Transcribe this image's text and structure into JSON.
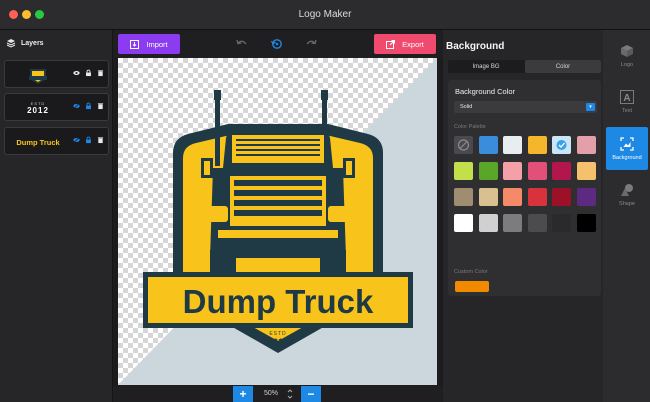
{
  "window": {
    "title": "Logo Maker"
  },
  "colors": {
    "accent": "#1e88e5",
    "import": "#8c3cf0",
    "export": "#f04a6e",
    "truck_yellow": "#f8c41c",
    "truck_dark": "#1f3a45"
  },
  "layers": {
    "title": "Layers",
    "items": [
      {
        "name": "truck-logo",
        "text": ""
      },
      {
        "name": "estd-2012",
        "text_top": "ESTD",
        "text_main": "2012"
      },
      {
        "name": "dump-truck-text",
        "text": "Dump Truck"
      }
    ]
  },
  "toolbar": {
    "import_label": "Import",
    "export_label": "Export"
  },
  "logo": {
    "title": "Dump Truck",
    "estd": "ESTD",
    "year": "2012"
  },
  "zoom": {
    "value": "50%",
    "plus": "+",
    "minus": "−"
  },
  "properties": {
    "title": "Background",
    "tabs": [
      {
        "label": "Image BG"
      },
      {
        "label": "Color"
      }
    ],
    "section_title": "Background Color",
    "fill_type": "Solid",
    "palette_label": "Color Palette",
    "custom_label": "Custom Color",
    "custom_color": "#f28a00",
    "palette": [
      "none",
      "#3a8ddb",
      "#e8eef0",
      "#f6b62b",
      "selected",
      "#e4a0a8",
      "#c3e04a",
      "#5aa628",
      "#f4a0a8",
      "#e2507a",
      "#b3164c",
      "#f5c16c",
      "#a08c70",
      "#d8c090",
      "#f58a68",
      "#d8323c",
      "#9c1028",
      "#5c2a80",
      "#ffffff",
      "#d0d0d0",
      "#7c7c7c",
      "#4c4c4e",
      "#2a2a2c",
      "#000000"
    ]
  },
  "tools": [
    {
      "label": "Logo",
      "icon": "cube-icon"
    },
    {
      "label": "Text",
      "icon": "text-icon"
    },
    {
      "label": "Background",
      "icon": "background-icon"
    },
    {
      "label": "Shape",
      "icon": "shape-icon"
    }
  ]
}
